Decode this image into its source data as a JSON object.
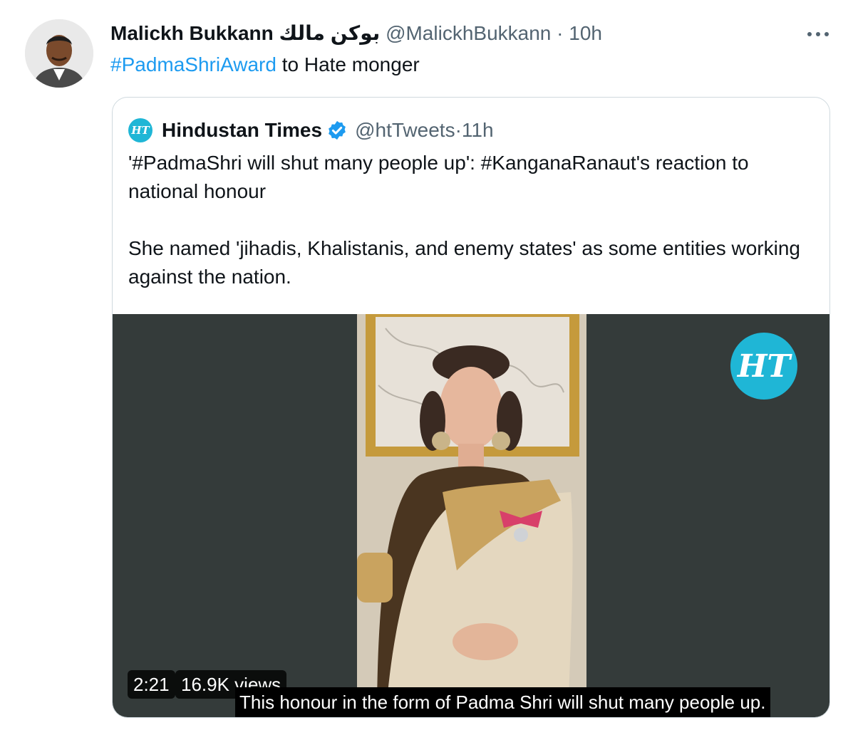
{
  "tweet": {
    "author_name": "Malickh Bukkann بوكن مالك",
    "author_handle": "@MalickhBukkann",
    "separator": "·",
    "time": "10h",
    "hashtag": "#PadmaShriAward",
    "text_rest": " to Hate monger",
    "avatar_icon": "user-avatar-photo",
    "more_icon": "more-options-icon"
  },
  "quote": {
    "logo_text": "HT",
    "name": "Hindustan Times",
    "verified_icon": "verified-badge-icon",
    "handle": "@htTweets",
    "separator": "·",
    "time": "11h",
    "paragraph1": "'#PadmaShri will shut many people up': #KanganaRanaut's reaction to national honour",
    "paragraph2": "She named 'jihadis, Khalistanis, and enemy states' as some entities working against the nation.",
    "media": {
      "badge_text": "HT",
      "duration": "2:21",
      "views": "16.9K views",
      "subtitle": "This honour in the form of Padma Shri will shut many people up."
    }
  },
  "colors": {
    "link": "#1d9bf0",
    "secondary_text": "#536471",
    "border": "#cfd9de",
    "ht_blue": "#1fb6d6",
    "video_bg": "#343b3a"
  }
}
